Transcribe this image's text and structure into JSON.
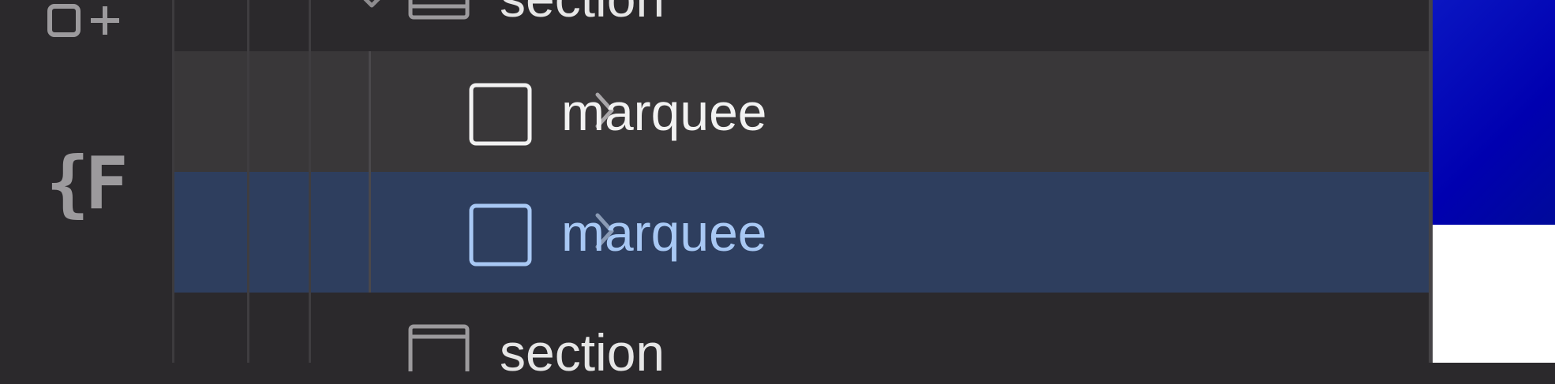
{
  "rail": {
    "icons": [
      "components-add-icon",
      "variables-icon"
    ],
    "variables_glyph": "{F"
  },
  "tree": {
    "rows": [
      {
        "label": "section",
        "icon": "section-icon",
        "expanded": true,
        "state": "normal"
      },
      {
        "label": "marquee",
        "icon": "element-box-icon",
        "expanded": false,
        "state": "hover"
      },
      {
        "label": "marquee",
        "icon": "element-box-icon",
        "expanded": false,
        "state": "selected"
      },
      {
        "label": "section",
        "icon": "section-icon",
        "expanded": false,
        "state": "normal"
      }
    ]
  },
  "colors": {
    "panel_bg": "#2b292c",
    "hover_bg": "#393739",
    "selected_bg": "#2e3e5e",
    "selected_text": "#a8c8f4",
    "canvas_blue": "#0000b0"
  }
}
